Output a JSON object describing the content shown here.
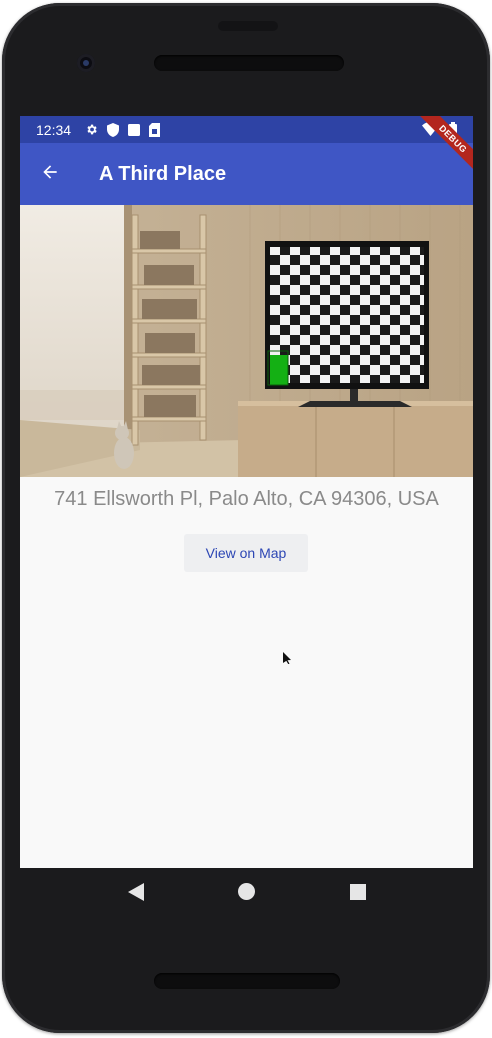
{
  "status_bar": {
    "time": "12:34",
    "icons": [
      "settings-icon",
      "shield-icon",
      "square-notification-icon",
      "sim-card-icon"
    ],
    "right_icons": [
      "wifi-icon",
      "battery-icon"
    ]
  },
  "app_bar": {
    "title": "A Third Place",
    "back_icon": "arrow-back-icon",
    "debug_banner": "DEBUG"
  },
  "place": {
    "image": "living-room-photo",
    "address": "741 Ellsworth Pl, Palo Alto, CA 94306, USA",
    "map_button_label": "View on Map"
  },
  "nav_bar": {
    "items": [
      "back-triangle-icon",
      "home-circle-icon",
      "recents-square-icon"
    ]
  },
  "colors": {
    "status_bar": "#2e43a5",
    "app_bar": "#3f56c5",
    "accent_text": "#2c46b4",
    "address_text": "#8a8a8a",
    "background": "#f9f9f9"
  }
}
